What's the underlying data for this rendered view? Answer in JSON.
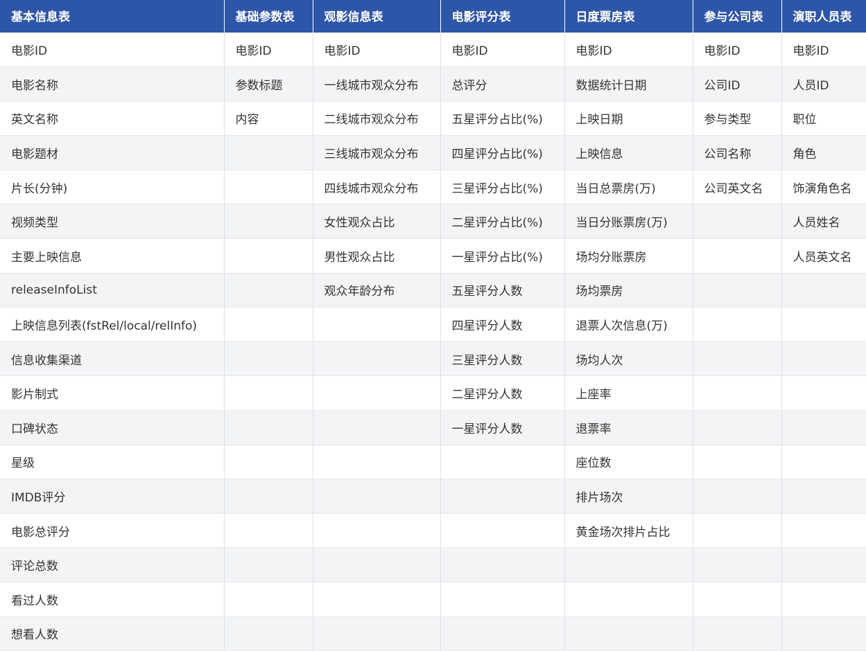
{
  "headers": [
    "基本信息表",
    "基础参数表",
    "观影信息表",
    "电影评分表",
    "日度票房表",
    "参与公司表",
    "演职人员表"
  ],
  "rows": [
    [
      "电影ID",
      "电影ID",
      "电影ID",
      "电影ID",
      "电影ID",
      "电影ID",
      "电影ID"
    ],
    [
      "电影名称",
      "参数标题",
      "一线城市观众分布",
      "总评分",
      "数据统计日期",
      "公司ID",
      "人员ID"
    ],
    [
      "英文名称",
      "内容",
      "二线城市观众分布",
      "五星评分占比(%)",
      "上映日期",
      "参与类型",
      "职位"
    ],
    [
      "电影题材",
      "",
      "三线城市观众分布",
      "四星评分占比(%)",
      "上映信息",
      "公司名称",
      "角色"
    ],
    [
      "片长(分钟)",
      "",
      "四线城市观众分布",
      "三星评分占比(%)",
      "当日总票房(万)",
      "公司英文名",
      "饰演角色名"
    ],
    [
      "视频类型",
      "",
      "女性观众占比",
      "二星评分占比(%)",
      "当日分账票房(万)",
      "",
      "人员姓名"
    ],
    [
      "主要上映信息",
      "",
      "男性观众占比",
      "一星评分占比(%)",
      "场均分账票房",
      "",
      "人员英文名"
    ],
    [
      "releaseInfoList",
      "",
      "观众年龄分布",
      "五星评分人数",
      "场均票房",
      "",
      ""
    ],
    [
      "上映信息列表(fstRel/local/relInfo)",
      "",
      "",
      "四星评分人数",
      "退票人次信息(万)",
      "",
      ""
    ],
    [
      "信息收集渠道",
      "",
      "",
      "三星评分人数",
      "场均人次",
      "",
      ""
    ],
    [
      "影片制式",
      "",
      "",
      "二星评分人数",
      "上座率",
      "",
      ""
    ],
    [
      "口碑状态",
      "",
      "",
      "一星评分人数",
      "退票率",
      "",
      ""
    ],
    [
      "星级",
      "",
      "",
      "",
      "座位数",
      "",
      ""
    ],
    [
      "IMDB评分",
      "",
      "",
      "",
      "排片场次",
      "",
      ""
    ],
    [
      "电影总评分",
      "",
      "",
      "",
      "黄金场次排片占比",
      "",
      ""
    ],
    [
      "评论总数",
      "",
      "",
      "",
      "",
      "",
      ""
    ],
    [
      "看过人数",
      "",
      "",
      "",
      "",
      "",
      ""
    ],
    [
      "想看人数",
      "",
      "",
      "",
      "",
      "",
      ""
    ]
  ],
  "colors": {
    "header_bg": "#2e56a8",
    "header_text": "#ffffff",
    "row_alt_bg": "#f3f4f6",
    "cell_text": "#333333"
  }
}
